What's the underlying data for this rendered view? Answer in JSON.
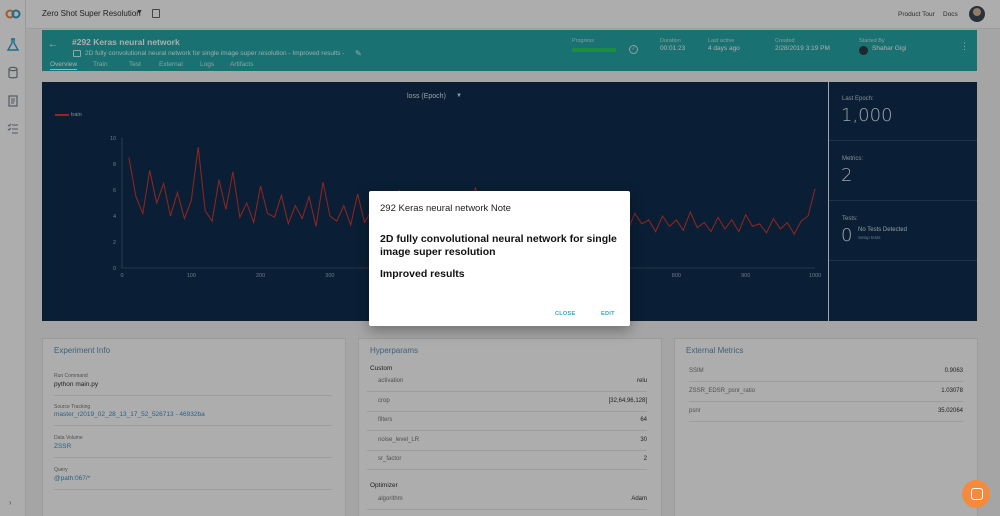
{
  "app": {
    "project_name": "Zero Shot Super Resolution",
    "links": [
      "Product Tour",
      "Docs"
    ]
  },
  "experiment": {
    "title": "#292 Keras neural network",
    "description": "2D fully convolutional neural network for single image super resolution - Improved results -",
    "tabs": [
      "Overview",
      "Train",
      "Test",
      "External",
      "Logs",
      "Artifacts"
    ],
    "active_tab": "Overview",
    "meta": {
      "progress_label": "Progress",
      "duration_label": "Duration",
      "duration": "00:01:23",
      "last_active_label": "Last active",
      "last_active": "4 days ago",
      "created_label": "Created",
      "created": "2/28/2019 3:19 PM",
      "started_by_label": "Started By",
      "started_by": "Shahar Gigi"
    },
    "progress_fraction": 1.0,
    "colors": {
      "header": "#26a7a8",
      "progress": "#2cd05c"
    }
  },
  "chart_data": {
    "type": "line",
    "title": "loss (Epoch)",
    "series": [
      {
        "name": "train",
        "color": "#d9382c"
      }
    ],
    "xlim": [
      0,
      1000
    ],
    "ylim": [
      0,
      10
    ],
    "x_ticks": [
      0,
      100,
      200,
      300,
      400,
      500,
      600,
      700,
      800,
      900,
      1000
    ],
    "y_ticks": [
      0,
      2,
      4,
      6,
      8,
      10
    ],
    "x": [
      10,
      20,
      30,
      40,
      50,
      60,
      70,
      80,
      90,
      100,
      110,
      120,
      130,
      140,
      150,
      160,
      170,
      180,
      190,
      200,
      210,
      220,
      230,
      240,
      250,
      260,
      270,
      280,
      290,
      300,
      310,
      320,
      330,
      340,
      350,
      360,
      370,
      380,
      390,
      400,
      410,
      420,
      430,
      440,
      450,
      460,
      470,
      480,
      490,
      500,
      510,
      520,
      530,
      540,
      550,
      560,
      570,
      580,
      590,
      600,
      610,
      620,
      630,
      640,
      650,
      660,
      670,
      680,
      690,
      700,
      710,
      720,
      730,
      740,
      750,
      760,
      770,
      780,
      790,
      800,
      810,
      820,
      830,
      840,
      850,
      860,
      870,
      880,
      890,
      900,
      910,
      920,
      930,
      940,
      950,
      960,
      970,
      980,
      990,
      1000
    ],
    "y": [
      8.5,
      5.5,
      4.2,
      7.5,
      5.0,
      6.5,
      4.0,
      5.8,
      3.8,
      5.2,
      9.3,
      4.4,
      3.6,
      6.8,
      4.5,
      7.4,
      3.9,
      5.0,
      3.5,
      6.3,
      4.2,
      3.9,
      5.6,
      3.4,
      4.8,
      3.8,
      5.5,
      3.2,
      6.6,
      4.0,
      3.6,
      4.8,
      3.3,
      5.7,
      3.5,
      4.4,
      3.2,
      4.7,
      3.0,
      6.0,
      3.8,
      3.4,
      4.6,
      3.1,
      4.2,
      3.6,
      5.5,
      3.2,
      4.3,
      3.0,
      6.2,
      3.7,
      3.3,
      4.8,
      3.0,
      4.1,
      3.5,
      4.9,
      3.2,
      4.6,
      3.0,
      3.9,
      5.2,
      3.1,
      4.5,
      2.9,
      3.8,
      4.2,
      3.0,
      4.6,
      3.3,
      3.8,
      2.9,
      4.2,
      3.4,
      3.7,
      2.8,
      4.0,
      3.2,
      3.7,
      2.9,
      4.3,
      3.1,
      3.5,
      2.8,
      3.9,
      3.0,
      3.7,
      2.8,
      4.1,
      3.2,
      3.4,
      2.7,
      3.8,
      3.0,
      3.5,
      2.6,
      3.6,
      4.0,
      6.1
    ]
  },
  "stats": {
    "last_epoch_label": "Last Epoch:",
    "last_epoch": "1,000",
    "metrics_label": "Metrics:",
    "metrics": "2",
    "tests_label": "Tests:",
    "tests": "0",
    "no_tests": "No Tests Detected",
    "setup_tests": "Setup tests"
  },
  "experiment_info": {
    "title": "Experiment Info",
    "run_command_label": "Run Command",
    "run_command": "python main.py",
    "source_tracking_label": "Source Tracking",
    "source_tracking": "master_r2019_02_28_13_17_52_526713 - 46932ba",
    "data_volume_label": "Data Volume",
    "data_volume": "ZSSR",
    "query_label": "Query",
    "query": "@path:067/*"
  },
  "hyperparams": {
    "title": "Hyperparams",
    "custom_label": "Custom",
    "custom": [
      {
        "key": "activation",
        "value": "relu"
      },
      {
        "key": "crop",
        "value": "[32,64,96,128]"
      },
      {
        "key": "filters",
        "value": "64"
      },
      {
        "key": "noise_level_LR",
        "value": "30"
      },
      {
        "key": "sr_factor",
        "value": "2"
      }
    ],
    "optimizer_label": "Optimizer",
    "optimizer": [
      {
        "key": "algorithm",
        "value": "Adam"
      }
    ]
  },
  "external_metrics": {
    "title": "External Metrics",
    "rows": [
      {
        "key": "SSIM",
        "value": "0.9063"
      },
      {
        "key": "ZSSR_EDSR_psnr_ratio",
        "value": "1.03078"
      },
      {
        "key": "psnr",
        "value": "35.02064"
      }
    ]
  },
  "modal": {
    "title": "292 Keras neural network Note",
    "heading": "2D fully convolutional neural network for single image super resolution",
    "subheading": "Improved results",
    "close_label": "CLOSE",
    "edit_label": "EDIT"
  }
}
